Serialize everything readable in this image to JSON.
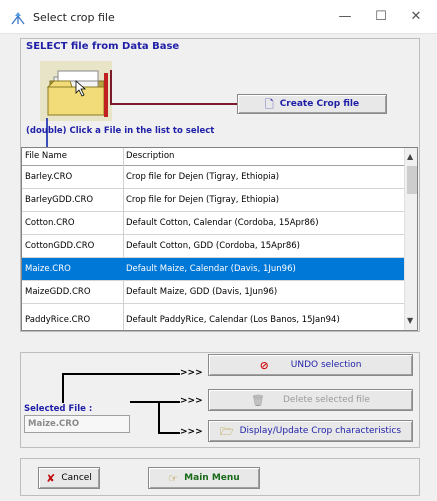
{
  "window": {
    "title": "Select crop file",
    "minimize": "—",
    "maximize": "☐",
    "close": "✕"
  },
  "header": {
    "title": "SELECT file from Data Base",
    "instruction": "(double) Click a File in the list to select"
  },
  "buttons": {
    "create": "Create Crop file",
    "undo": "UNDO selection",
    "delete": "Delete selected file",
    "display": "Display/Update Crop characteristics",
    "cancel": "Cancel",
    "main_menu": "Main Menu"
  },
  "table": {
    "columns": [
      "File Name",
      "Description"
    ],
    "rows": [
      {
        "file": "Barley.CRO",
        "desc": "Crop file for Dejen (Tigray, Ethiopia)"
      },
      {
        "file": "BarleyGDD.CRO",
        "desc": "Crop file for Dejen (Tigray, Ethiopia)"
      },
      {
        "file": "Cotton.CRO",
        "desc": "Default Cotton, Calendar (Cordoba, 15Apr86)"
      },
      {
        "file": "CottonGDD.CRO",
        "desc": "Default Cotton, GDD (Cordoba, 15Apr86)"
      },
      {
        "file": "Maize.CRO",
        "desc": "Default Maize, Calendar (Davis, 1Jun96)"
      },
      {
        "file": "MaizeGDD.CRO",
        "desc": "Default Maize, GDD (Davis, 1Jun96)"
      },
      {
        "file": "PaddyRice.CRO",
        "desc": "Default PaddyRice, Calendar (Los Banos, 15Jan94)"
      }
    ],
    "selected_index": 4
  },
  "selection": {
    "label": "Selected File :",
    "value": "Maize.CRO",
    "arrows": ">>>"
  },
  "colors": {
    "accent_text": "#1f1fa8",
    "selection": "#0078d7",
    "connector": "#7a1a2a"
  }
}
